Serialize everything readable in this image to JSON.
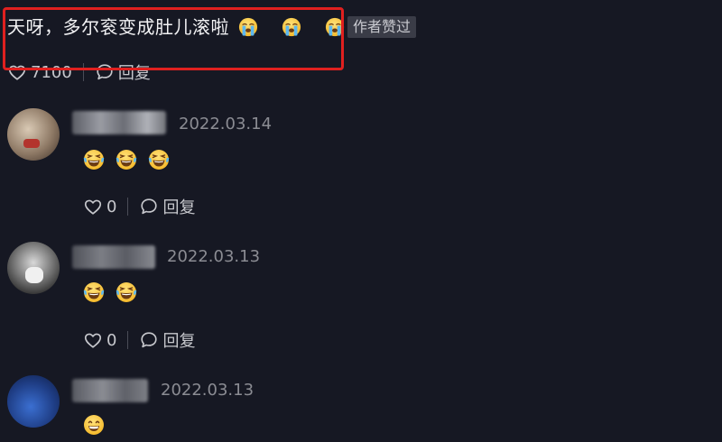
{
  "top_comment": {
    "text": "天呀，多尔衮变成肚儿滚啦",
    "emojis": [
      "crying-face",
      "crying-face",
      "crying-face"
    ],
    "author_badge": "作者赞过",
    "likes": "7100",
    "reply_label": "回复"
  },
  "replies": [
    {
      "date": "2022.03.14",
      "emojis": [
        "laughing-tears",
        "laughing-tears",
        "laughing-tears"
      ],
      "likes": "0",
      "reply_label": "回复"
    },
    {
      "date": "2022.03.13",
      "emojis": [
        "laughing-tears",
        "laughing-tears"
      ],
      "likes": "0",
      "reply_label": "回复"
    },
    {
      "date": "2022.03.13",
      "emojis": [
        "grinning-face"
      ]
    }
  ],
  "colors": {
    "background": "#161823",
    "highlight_box": "#e0201f",
    "secondary_text": "#8b8c93"
  }
}
